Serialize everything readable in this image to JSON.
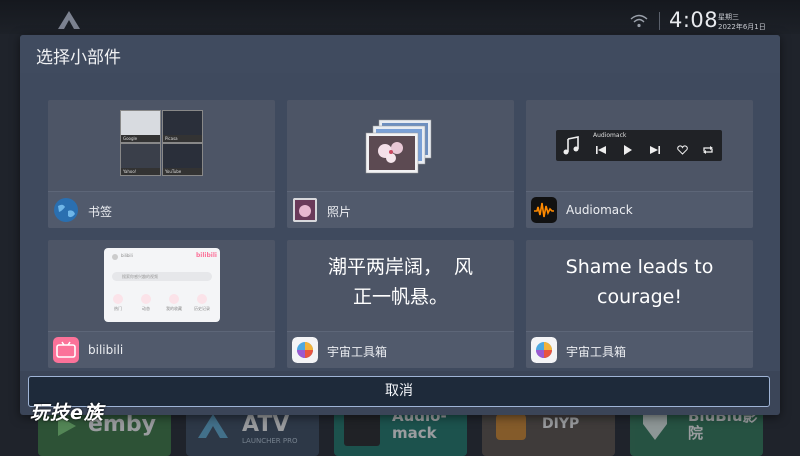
{
  "status_bar": {
    "time": "4:08",
    "weekday": "星期三",
    "date": "2022年6月1日",
    "icons": [
      "launcher-logo-icon",
      "wifi-icon"
    ]
  },
  "dialog": {
    "title": "选择小部件",
    "cancel_label": "取消",
    "widgets": [
      {
        "app_name": "书签",
        "icon": "globe-icon",
        "preview": "bookmark-thumbnails",
        "thumb_labels": [
          "Google",
          "Picasa",
          "Yahoo!",
          "YouTube"
        ]
      },
      {
        "app_name": "照片",
        "icon": "photo-icon",
        "preview": "photo-stack"
      },
      {
        "app_name": "Audiomack",
        "icon": "audiomack-icon",
        "preview": "player",
        "player_title": "Audiomack"
      },
      {
        "app_name": "bilibili",
        "icon": "bilibili-icon",
        "preview": "bilibili-panel",
        "panel_logo": "bilibili",
        "search_placeholder": "搜索你感兴趣的视频",
        "shortcuts": [
          "热门",
          "动态",
          "我的收藏",
          "历史记录"
        ]
      },
      {
        "app_name": "宇宙工具箱",
        "icon": "toolbox-icon",
        "preview": "text",
        "text": "潮平两岸阔，  风\n正一帆悬。"
      },
      {
        "app_name": "宇宙工具箱",
        "icon": "toolbox-icon",
        "preview": "text",
        "text": "Shame leads to courage!"
      }
    ]
  },
  "dock": {
    "tiles": [
      "emby",
      "ATV",
      "Audio-\nmack",
      "DIYP",
      "BiuBiu影\n院"
    ],
    "atv_sub": "LAUNCHER PRO"
  },
  "watermark": "玩技e族"
}
